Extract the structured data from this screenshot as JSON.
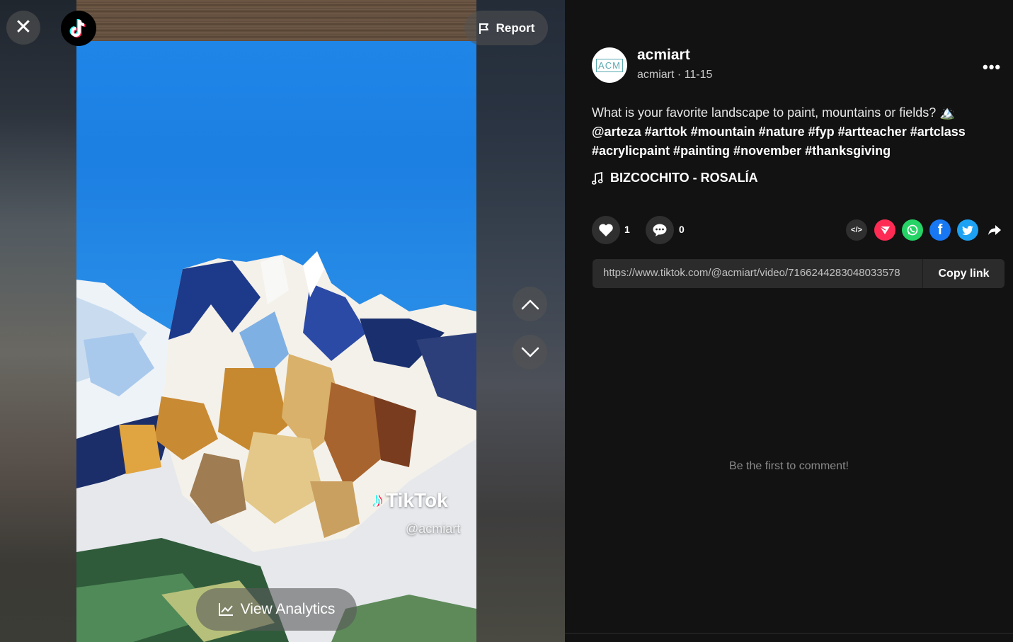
{
  "video": {
    "watermark_brand": "TikTok",
    "watermark_handle": "@acmiart",
    "report_label": "Report",
    "analytics_label": "View Analytics"
  },
  "post": {
    "avatar_text": "ACM",
    "username": "acmiart",
    "handle": "acmiart",
    "date": "11-15",
    "caption": "What is your favorite landscape to paint, mountains or fields? 🏔️",
    "hashtags": "@arteza #arttok #mountain #nature #fyp #artteacher #artclass #acrylicpaint #painting #november #thanksgiving",
    "music": "BIZCOCHITO - ROSALÍA",
    "likes": "1",
    "comments": "0"
  },
  "share": {
    "link": "https://www.tiktok.com/@acmiart/video/7166244283048033578",
    "copy_label": "Copy link",
    "icons": [
      "embed-icon",
      "tiktok-send-icon",
      "whatsapp-icon",
      "facebook-icon",
      "twitter-icon",
      "share-arrow-icon"
    ],
    "colors": {
      "send": "#fe2c55",
      "whatsapp": "#25d366",
      "facebook": "#1877f2",
      "twitter": "#1da1f2"
    }
  },
  "comments_section": {
    "empty_text": "Be the first to comment!"
  }
}
